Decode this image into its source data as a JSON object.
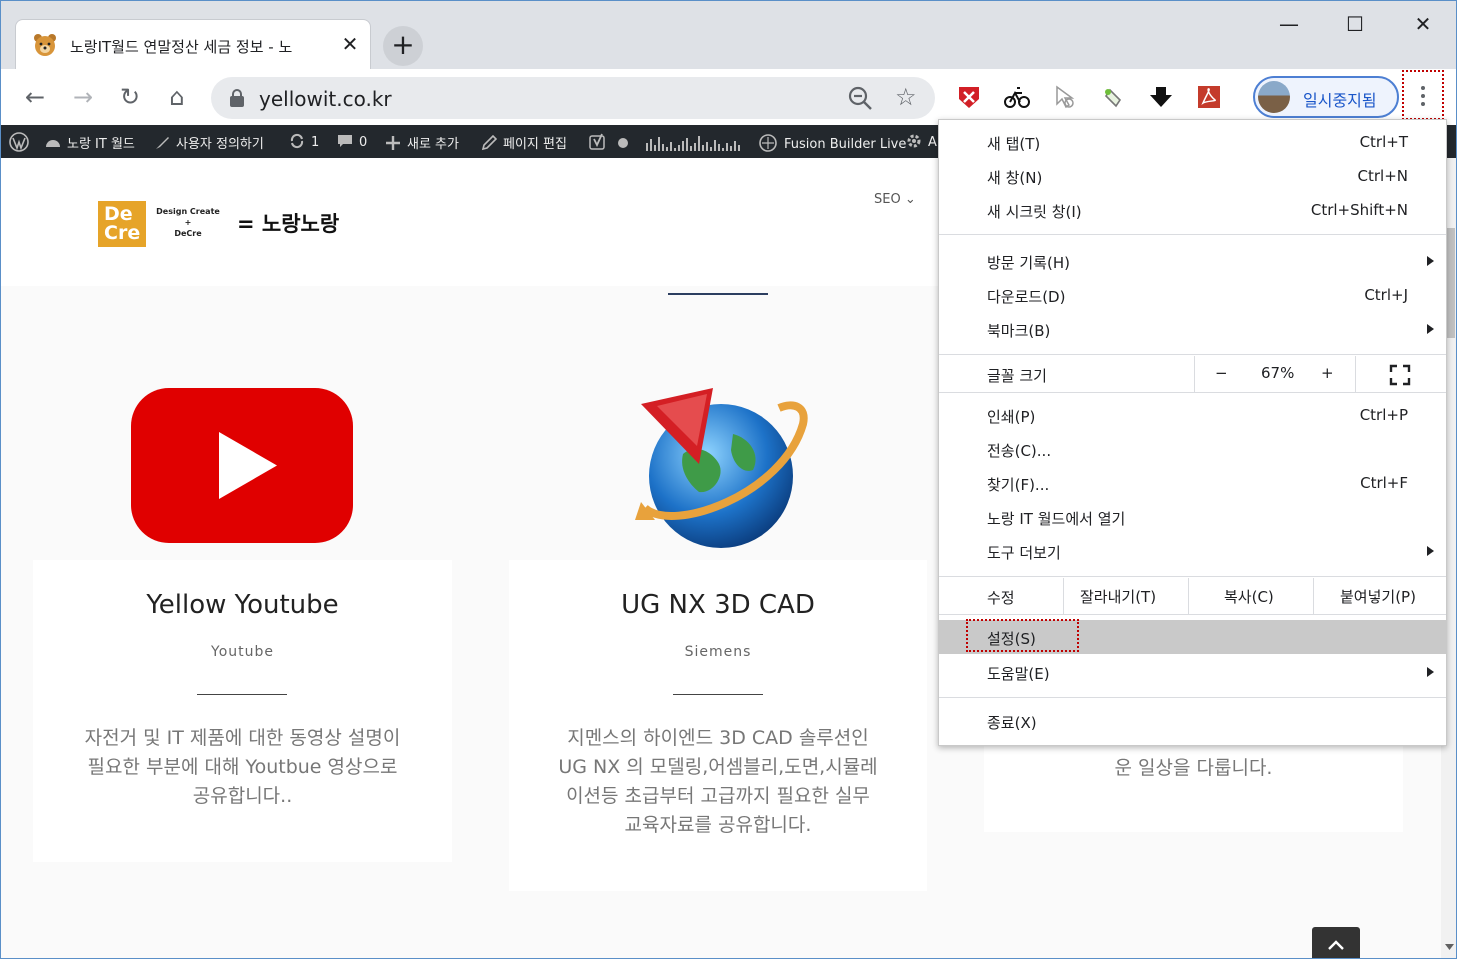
{
  "tab": {
    "title": "노랑IT월드 연말정산 세금 정보 - 노",
    "close": "✕"
  },
  "newtab": "+",
  "window": {
    "minimize": "—",
    "maximize": "☐",
    "close": "✕"
  },
  "nav": {
    "back": "←",
    "forward": "→",
    "reload": "↻",
    "home": "⌂"
  },
  "omnibox": {
    "url": "yellowit.co.kr",
    "star": "☆"
  },
  "profile": {
    "label": "일시중지됨"
  },
  "adminbar": {
    "items": [
      {
        "label": "노랑 IT 월드"
      },
      {
        "label": "사용자 정의하기"
      },
      {
        "label": "1"
      },
      {
        "label": "0"
      },
      {
        "label": "새로 추가"
      },
      {
        "label": "페이지 편집"
      },
      {
        "label": "Fusion Builder Live"
      },
      {
        "label": "A"
      }
    ]
  },
  "site": {
    "logo_box": "De Cre",
    "logo_small_top": "Design Create",
    "logo_small_plus": "+",
    "logo_small_bottom": "DeCre",
    "logo_name": "= 노랑노랑",
    "seo": "SEO ⌄"
  },
  "cards": [
    {
      "title": "Yellow Youtube",
      "sub": "Youtube",
      "desc": "자전거 및 IT 제품에 대한 동영상 설명이 필요한 부분에 대해 Youtbue 영상으로 공유합니다.."
    },
    {
      "title": "UG NX 3D CAD",
      "sub": "Siemens",
      "desc": "지멘스의 하이엔드 3D CAD 솔루션인 UG NX 의 모델링,어셈블리,도면,시뮬레이션등 초급부터 고급까지 필요한 실무 교육자료를 공유합니다."
    },
    {
      "desc": "운 일상을 다룹니다."
    }
  ],
  "menu": {
    "new_tab": {
      "label": "새 탭(T)",
      "shortcut": "Ctrl+T"
    },
    "new_window": {
      "label": "새 창(N)",
      "shortcut": "Ctrl+N"
    },
    "incognito": {
      "label": "새 시크릿 창(I)",
      "shortcut": "Ctrl+Shift+N"
    },
    "history": {
      "label": "방문 기록(H)"
    },
    "downloads": {
      "label": "다운로드(D)",
      "shortcut": "Ctrl+J"
    },
    "bookmarks": {
      "label": "북마크(B)"
    },
    "zoom": {
      "label": "글꼴 크기",
      "minus": "−",
      "value": "67%",
      "plus": "+"
    },
    "print": {
      "label": "인쇄(P)",
      "shortcut": "Ctrl+P"
    },
    "cast": {
      "label": "전송(C)..."
    },
    "find": {
      "label": "찾기(F)...",
      "shortcut": "Ctrl+F"
    },
    "open_in": {
      "label": "노랑 IT 월드에서 열기"
    },
    "more_tools": {
      "label": "도구 더보기"
    },
    "edit": {
      "label": "수정",
      "cut": "잘라내기(T)",
      "copy": "복사(C)",
      "paste": "붙여넣기(P)"
    },
    "settings": {
      "label": "설정(S)"
    },
    "help": {
      "label": "도움말(E)"
    },
    "exit": {
      "label": "종료(X)"
    }
  },
  "colors": {
    "accent": "#c00000",
    "profile": "#1a56c9",
    "adminbar": "#23282d",
    "youtube": "#e00000",
    "logo": "#e6a429"
  }
}
